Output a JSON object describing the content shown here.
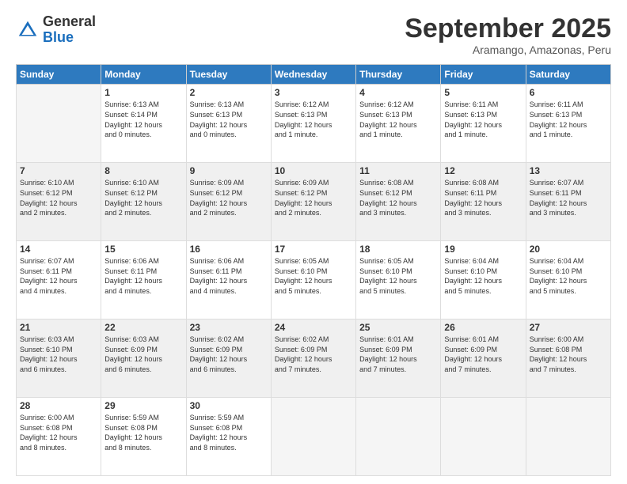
{
  "logo": {
    "general": "General",
    "blue": "Blue"
  },
  "header": {
    "month": "September 2025",
    "location": "Aramango, Amazonas, Peru"
  },
  "weekdays": [
    "Sunday",
    "Monday",
    "Tuesday",
    "Wednesday",
    "Thursday",
    "Friday",
    "Saturday"
  ],
  "weeks": [
    [
      {
        "day": "",
        "empty": true
      },
      {
        "day": "1",
        "sunrise": "6:13 AM",
        "sunset": "6:14 PM",
        "daylight": "12 hours and 0 minutes."
      },
      {
        "day": "2",
        "sunrise": "6:13 AM",
        "sunset": "6:13 PM",
        "daylight": "12 hours and 0 minutes."
      },
      {
        "day": "3",
        "sunrise": "6:12 AM",
        "sunset": "6:13 PM",
        "daylight": "12 hours and 1 minute."
      },
      {
        "day": "4",
        "sunrise": "6:12 AM",
        "sunset": "6:13 PM",
        "daylight": "12 hours and 1 minute."
      },
      {
        "day": "5",
        "sunrise": "6:11 AM",
        "sunset": "6:13 PM",
        "daylight": "12 hours and 1 minute."
      },
      {
        "day": "6",
        "sunrise": "6:11 AM",
        "sunset": "6:13 PM",
        "daylight": "12 hours and 1 minute."
      }
    ],
    [
      {
        "day": "7",
        "sunrise": "6:10 AM",
        "sunset": "6:12 PM",
        "daylight": "12 hours and 2 minutes."
      },
      {
        "day": "8",
        "sunrise": "6:10 AM",
        "sunset": "6:12 PM",
        "daylight": "12 hours and 2 minutes."
      },
      {
        "day": "9",
        "sunrise": "6:09 AM",
        "sunset": "6:12 PM",
        "daylight": "12 hours and 2 minutes."
      },
      {
        "day": "10",
        "sunrise": "6:09 AM",
        "sunset": "6:12 PM",
        "daylight": "12 hours and 2 minutes."
      },
      {
        "day": "11",
        "sunrise": "6:08 AM",
        "sunset": "6:12 PM",
        "daylight": "12 hours and 3 minutes."
      },
      {
        "day": "12",
        "sunrise": "6:08 AM",
        "sunset": "6:11 PM",
        "daylight": "12 hours and 3 minutes."
      },
      {
        "day": "13",
        "sunrise": "6:07 AM",
        "sunset": "6:11 PM",
        "daylight": "12 hours and 3 minutes."
      }
    ],
    [
      {
        "day": "14",
        "sunrise": "6:07 AM",
        "sunset": "6:11 PM",
        "daylight": "12 hours and 4 minutes."
      },
      {
        "day": "15",
        "sunrise": "6:06 AM",
        "sunset": "6:11 PM",
        "daylight": "12 hours and 4 minutes."
      },
      {
        "day": "16",
        "sunrise": "6:06 AM",
        "sunset": "6:11 PM",
        "daylight": "12 hours and 4 minutes."
      },
      {
        "day": "17",
        "sunrise": "6:05 AM",
        "sunset": "6:10 PM",
        "daylight": "12 hours and 5 minutes."
      },
      {
        "day": "18",
        "sunrise": "6:05 AM",
        "sunset": "6:10 PM",
        "daylight": "12 hours and 5 minutes."
      },
      {
        "day": "19",
        "sunrise": "6:04 AM",
        "sunset": "6:10 PM",
        "daylight": "12 hours and 5 minutes."
      },
      {
        "day": "20",
        "sunrise": "6:04 AM",
        "sunset": "6:10 PM",
        "daylight": "12 hours and 5 minutes."
      }
    ],
    [
      {
        "day": "21",
        "sunrise": "6:03 AM",
        "sunset": "6:10 PM",
        "daylight": "12 hours and 6 minutes."
      },
      {
        "day": "22",
        "sunrise": "6:03 AM",
        "sunset": "6:09 PM",
        "daylight": "12 hours and 6 minutes."
      },
      {
        "day": "23",
        "sunrise": "6:02 AM",
        "sunset": "6:09 PM",
        "daylight": "12 hours and 6 minutes."
      },
      {
        "day": "24",
        "sunrise": "6:02 AM",
        "sunset": "6:09 PM",
        "daylight": "12 hours and 7 minutes."
      },
      {
        "day": "25",
        "sunrise": "6:01 AM",
        "sunset": "6:09 PM",
        "daylight": "12 hours and 7 minutes."
      },
      {
        "day": "26",
        "sunrise": "6:01 AM",
        "sunset": "6:09 PM",
        "daylight": "12 hours and 7 minutes."
      },
      {
        "day": "27",
        "sunrise": "6:00 AM",
        "sunset": "6:08 PM",
        "daylight": "12 hours and 7 minutes."
      }
    ],
    [
      {
        "day": "28",
        "sunrise": "6:00 AM",
        "sunset": "6:08 PM",
        "daylight": "12 hours and 8 minutes."
      },
      {
        "day": "29",
        "sunrise": "5:59 AM",
        "sunset": "6:08 PM",
        "daylight": "12 hours and 8 minutes."
      },
      {
        "day": "30",
        "sunrise": "5:59 AM",
        "sunset": "6:08 PM",
        "daylight": "12 hours and 8 minutes."
      },
      {
        "day": "",
        "empty": true
      },
      {
        "day": "",
        "empty": true
      },
      {
        "day": "",
        "empty": true
      },
      {
        "day": "",
        "empty": true
      }
    ]
  ]
}
